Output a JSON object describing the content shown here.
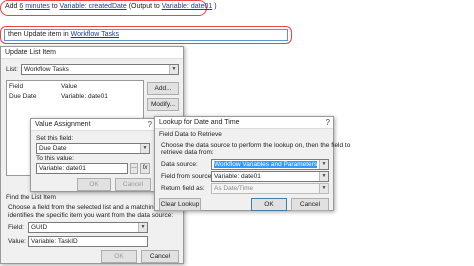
{
  "workflow": {
    "step1": {
      "prefix": "Add",
      "amount": "6",
      "unit": "minutes",
      "to": "to",
      "variable": "Variable: createdDate",
      "output_prefix": "(Output to",
      "output_var": "Variable: date01",
      "output_suffix": ")"
    },
    "step2": {
      "prefix": "then Update item in",
      "list": "Workflow Tasks"
    }
  },
  "update_list_item": {
    "title": "Update List Item",
    "list_label": "List:",
    "list_value": "Workflow Tasks",
    "col_field": "Field",
    "col_value": "Value",
    "row_field": "Due Date",
    "row_value": "Variable: date01",
    "add_button": "Add...",
    "modify_button": "Modify...",
    "find_label": "Find the List Item",
    "find_desc_1": "Choose a field from the selected list and a matching value that",
    "find_desc_2": "identifies the specific item you want from the data source:",
    "field_label": "Field:",
    "field_value": "GUID",
    "value_label": "Value:",
    "value_value": "Variable: TaskID",
    "ok_button": "OK",
    "cancel_button": "Cancel"
  },
  "value_assignment": {
    "title": "Value Assignment",
    "set_field_label": "Set this field:",
    "set_field_value": "Due Date",
    "to_value_label": "To this value:",
    "to_value_value": "Variable: date01",
    "fx": "fx",
    "ok_button": "OK",
    "cancel_button": "Cancel"
  },
  "lookup": {
    "title": "Lookup for Date and Time",
    "section": "Field Data to Retrieve",
    "desc_1": "Choose the data source to perform the lookup on, then the field to",
    "desc_2": "retrieve data from:",
    "data_source_label": "Data source:",
    "data_source_value": "Workflow Variables and Parameters",
    "field_from_label": "Field from source:",
    "field_from_value": "Variable: date01",
    "return_as_label": "Return field as:",
    "return_as_value": "As Date/Time",
    "clear_button": "Clear Lookup",
    "ok_button": "OK",
    "cancel_button": "Cancel"
  },
  "colors": {
    "highlight": "#3399ff",
    "step_border": "#ee4444",
    "link": "#1a3f8a"
  }
}
